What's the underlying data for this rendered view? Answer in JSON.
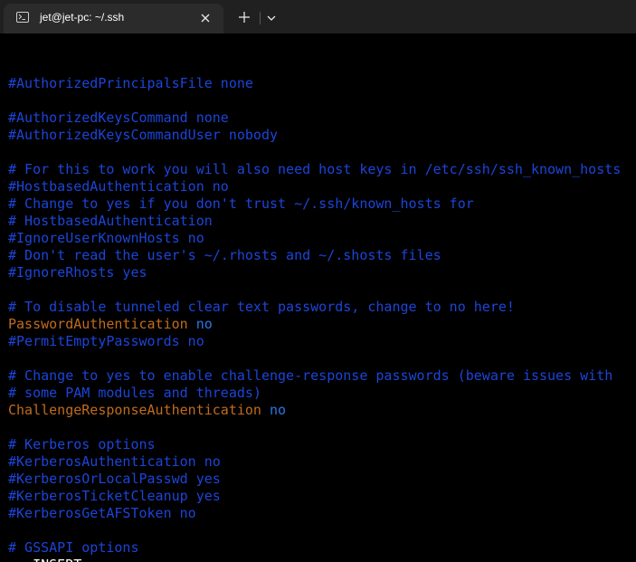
{
  "tab": {
    "title": "jet@jet-pc: ~/.ssh",
    "icon": "terminal-icon",
    "close_icon": "close-icon"
  },
  "titlebar": {
    "new_tab_icon": "plus-icon",
    "dropdown_icon": "chevron-down-icon"
  },
  "colors": {
    "comment": "#1c45d8",
    "keyword": "#c06c1c",
    "value": "#2a78e8",
    "background": "#000000"
  },
  "editor": {
    "lines": [
      {
        "type": "blank",
        "text": ""
      },
      {
        "type": "comment",
        "text": "#AuthorizedPrincipalsFile none"
      },
      {
        "type": "blank",
        "text": ""
      },
      {
        "type": "comment",
        "text": "#AuthorizedKeysCommand none"
      },
      {
        "type": "comment",
        "text": "#AuthorizedKeysCommandUser nobody"
      },
      {
        "type": "blank",
        "text": ""
      },
      {
        "type": "comment",
        "text": "# For this to work you will also need host keys in /etc/ssh/ssh_known_hosts"
      },
      {
        "type": "comment",
        "text": "#HostbasedAuthentication no"
      },
      {
        "type": "comment",
        "text": "# Change to yes if you don't trust ~/.ssh/known_hosts for"
      },
      {
        "type": "comment",
        "text": "# HostbasedAuthentication"
      },
      {
        "type": "comment",
        "text": "#IgnoreUserKnownHosts no"
      },
      {
        "type": "comment",
        "text": "# Don't read the user's ~/.rhosts and ~/.shosts files"
      },
      {
        "type": "comment",
        "text": "#IgnoreRhosts yes"
      },
      {
        "type": "blank",
        "text": ""
      },
      {
        "type": "comment",
        "text": "# To disable tunneled clear text passwords, change to no here!"
      },
      {
        "type": "directive",
        "key": "PasswordAuthentication",
        "value": "no"
      },
      {
        "type": "comment",
        "text": "#PermitEmptyPasswords no"
      },
      {
        "type": "blank",
        "text": ""
      },
      {
        "type": "comment",
        "text": "# Change to yes to enable challenge-response passwords (beware issues with"
      },
      {
        "type": "comment",
        "text": "# some PAM modules and threads)"
      },
      {
        "type": "directive",
        "key": "ChallengeResponseAuthentication",
        "value": "no"
      },
      {
        "type": "blank",
        "text": ""
      },
      {
        "type": "comment",
        "text": "# Kerberos options"
      },
      {
        "type": "comment",
        "text": "#KerberosAuthentication no"
      },
      {
        "type": "comment",
        "text": "#KerberosOrLocalPasswd yes"
      },
      {
        "type": "comment",
        "text": "#KerberosTicketCleanup yes"
      },
      {
        "type": "comment",
        "text": "#KerberosGetAFSToken no"
      },
      {
        "type": "blank",
        "text": ""
      },
      {
        "type": "comment",
        "text": "# GSSAPI options"
      }
    ],
    "status": "-- INSERT --"
  }
}
